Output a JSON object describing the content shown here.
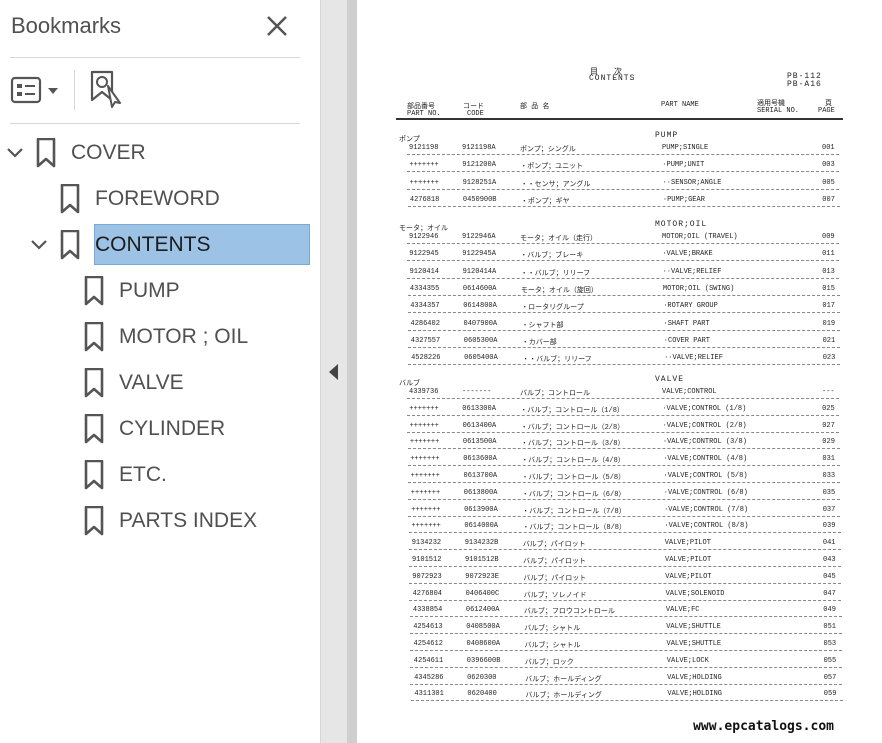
{
  "sidebar": {
    "title": "Bookmarks",
    "items": [
      {
        "label": "COVER",
        "expanded": true,
        "level": 0
      },
      {
        "label": "FOREWORD",
        "level": 1
      },
      {
        "label": "CONTENTS",
        "expanded": true,
        "selected": true,
        "level": 1
      },
      {
        "label": "PUMP",
        "level": 2
      },
      {
        "label": "MOTOR ; OIL",
        "level": 2
      },
      {
        "label": "VALVE",
        "level": 2
      },
      {
        "label": "CYLINDER",
        "level": 2
      },
      {
        "label": "ETC.",
        "level": 2
      },
      {
        "label": "PARTS INDEX",
        "level": 2
      }
    ]
  },
  "document": {
    "title_jp": "目　　次",
    "title": "CONTENTS",
    "doc_code_1": "PB-112",
    "doc_code_2": "PB-A16",
    "headers": {
      "part_no_jp": "部品番号",
      "part_no": "PART NO.",
      "code_jp": "コード",
      "code": "CODE",
      "name_jp": "部 品 名",
      "part_name": "PART NAME",
      "serial_jp": "適用号機",
      "serial": "SERIAL NO.",
      "page_jp": "頁",
      "page": "PAGE"
    },
    "sections": [
      {
        "jp": "ポンプ",
        "en": "PUMP",
        "rows": [
          {
            "part_no": "9121198",
            "code": "9121198A",
            "name_jp": "ポンプ；シングル",
            "name": "PUMP;SINGLE",
            "page": "001"
          },
          {
            "part_no": "+++++++",
            "code": "9121200A",
            "name_jp": "・ポンプ；ユニット",
            "name": "·PUMP;UNIT",
            "page": "003"
          },
          {
            "part_no": "+++++++",
            "code": "9128251A",
            "name_jp": "・・センサ；アングル",
            "name": "··SENSOR;ANGLE",
            "page": "005"
          },
          {
            "part_no": "4276818",
            "code": "0450900B",
            "name_jp": "・ポンプ；ギヤ",
            "name": "·PUMP;GEAR",
            "page": "007"
          }
        ]
      },
      {
        "jp": "モータ；オイル",
        "en": "MOTOR;OIL",
        "rows": [
          {
            "part_no": "9122946",
            "code": "9122946A",
            "name_jp": "モータ；オイル（走行）",
            "name": "MOTOR;OIL (TRAVEL)",
            "page": "009"
          },
          {
            "part_no": "9122945",
            "code": "9122945A",
            "name_jp": "・バルブ；ブレーキ",
            "name": "·VALVE;BRAKE",
            "page": "011"
          },
          {
            "part_no": "9120414",
            "code": "9120414A",
            "name_jp": "・・バルブ；リリーフ",
            "name": "··VALVE;RELIEF",
            "page": "013"
          },
          {
            "part_no": "4334355",
            "code": "0614600A",
            "name_jp": "モータ；オイル（旋回）",
            "name": "MOTOR;OIL (SWING)",
            "page": "015"
          },
          {
            "part_no": "4334357",
            "code": "0614800A",
            "name_jp": "・ロータリグループ",
            "name": "·ROTARY GROUP",
            "page": "017"
          },
          {
            "part_no": "4286402",
            "code": "0407900A",
            "name_jp": "・シャフト部",
            "name": "·SHAFT PART",
            "page": "019"
          },
          {
            "part_no": "4327557",
            "code": "0605300A",
            "name_jp": "・カバー部",
            "name": "·COVER PART",
            "page": "021"
          },
          {
            "part_no": "4528226",
            "code": "0605400A",
            "name_jp": "・・バルブ；リリーフ",
            "name": "··VALVE;RELIEF",
            "page": "023"
          }
        ]
      },
      {
        "jp": "バルブ",
        "en": "VALVE",
        "rows": [
          {
            "part_no": "4339736",
            "code": "-------",
            "name_jp": "バルブ；コントロール",
            "name": "VALVE;CONTROL",
            "page": "---"
          },
          {
            "part_no": "+++++++",
            "code": "0613300A",
            "name_jp": "・バルブ；コントロール（1/8）",
            "name": "·VALVE;CONTROL (1/8)",
            "page": "025"
          },
          {
            "part_no": "+++++++",
            "code": "0613400A",
            "name_jp": "・バルブ；コントロール（2/8）",
            "name": "·VALVE;CONTROL (2/8)",
            "page": "027"
          },
          {
            "part_no": "+++++++",
            "code": "0613500A",
            "name_jp": "・バルブ；コントロール（3/8）",
            "name": "·VALVE;CONTROL (3/8)",
            "page": "029"
          },
          {
            "part_no": "+++++++",
            "code": "0613600A",
            "name_jp": "・バルブ；コントロール（4/8）",
            "name": "·VALVE;CONTROL (4/8)",
            "page": "031"
          },
          {
            "part_no": "+++++++",
            "code": "0613700A",
            "name_jp": "・バルブ；コントロール（5/8）",
            "name": "·VALVE;CONTROL (5/8)",
            "page": "033"
          },
          {
            "part_no": "+++++++",
            "code": "0613800A",
            "name_jp": "・バルブ；コントロール（6/8）",
            "name": "·VALVE;CONTROL (6/8)",
            "page": "035"
          },
          {
            "part_no": "+++++++",
            "code": "0613900A",
            "name_jp": "・バルブ；コントロール（7/8）",
            "name": "·VALVE;CONTROL (7/8)",
            "page": "037"
          },
          {
            "part_no": "+++++++",
            "code": "0614000A",
            "name_jp": "・バルブ；コントロール（8/8）",
            "name": "·VALVE;CONTROL (8/8)",
            "page": "039"
          },
          {
            "part_no": "9134232",
            "code": "9134232B",
            "name_jp": "バルブ；パイロット",
            "name": "VALVE;PILOT",
            "page": "041"
          },
          {
            "part_no": "9101512",
            "code": "9101512B",
            "name_jp": "バルブ；パイロット",
            "name": "VALVE;PILOT",
            "page": "043"
          },
          {
            "part_no": "9072923",
            "code": "9072923E",
            "name_jp": "バルブ；パイロット",
            "name": "VALVE;PILOT",
            "page": "045"
          },
          {
            "part_no": "4276804",
            "code": "0406400C",
            "name_jp": "バルブ；ソレノイド",
            "name": "VALVE;SOLENOID",
            "page": "047"
          },
          {
            "part_no": "4338854",
            "code": "0612400A",
            "name_jp": "バルブ；フロウコントロール",
            "name": "VALVE;FC",
            "page": "049"
          },
          {
            "part_no": "4254613",
            "code": "0408500A",
            "name_jp": "バルブ；シャトル",
            "name": "VALVE;SHUTTLE",
            "page": "051"
          },
          {
            "part_no": "4254612",
            "code": "0408600A",
            "name_jp": "バルブ；シャトル",
            "name": "VALVE;SHUTTLE",
            "page": "053"
          },
          {
            "part_no": "4254611",
            "code": "0396600B",
            "name_jp": "バルブ；ロック",
            "name": "VALVE;LOCK",
            "page": "055"
          },
          {
            "part_no": "4345286",
            "code": "0620300",
            "name_jp": "バルブ；ホールディング",
            "name": "VALVE;HOLDING",
            "page": "057"
          },
          {
            "part_no": "4311301",
            "code": "0620400",
            "name_jp": "バルブ；ホールディング",
            "name": "VALVE;HOLDING",
            "page": "059"
          }
        ]
      }
    ],
    "watermark": "www.epcatalogs.com"
  },
  "colors": {
    "selection": "#9cc3e5",
    "sidebar_text": "#505050",
    "divider": "#e6e6e6",
    "gutter": "#cfcfcf"
  },
  "icons": [
    "close-icon",
    "options-icon",
    "find-bookmark-icon",
    "bookmark-icon",
    "chevron-down-icon",
    "collapse-panel-icon"
  ]
}
